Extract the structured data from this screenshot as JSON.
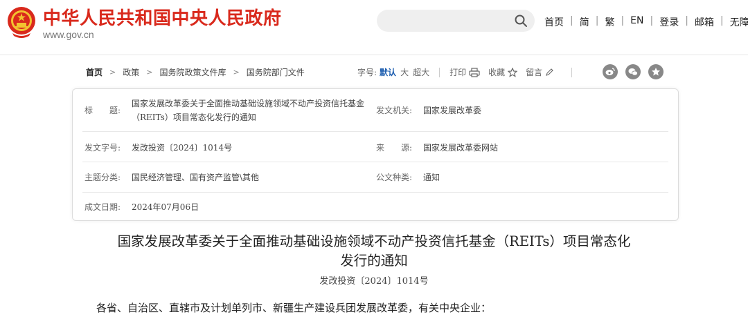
{
  "header": {
    "site_title": "中华人民共和国中央人民政府",
    "site_url": "www.gov.cn",
    "search_placeholder": "",
    "nav": [
      "首页",
      "简",
      "繁",
      "EN",
      "登录",
      "邮箱",
      "无障碍"
    ],
    "brand_color": "#d9291c"
  },
  "breadcrumb": [
    "首页",
    "政策",
    "国务院政策文件库",
    "国务院部门文件"
  ],
  "tools": {
    "font_label": "字号:",
    "font_default": "默认",
    "font_large": "大",
    "font_xlarge": "超大",
    "print": "打印",
    "favorite": "收藏",
    "comment": "留言"
  },
  "share_icons": [
    "weibo-icon",
    "wechat-icon",
    "qzone-icon"
  ],
  "info": {
    "title_label": "标　　题:",
    "title_line1": "国家发展改革委关于全面推动基础设施领域不动产投资信托基金",
    "title_line2": "（REITs）项目常态化发行的通知",
    "issuer_label": "发文机关:",
    "issuer": "国家发展改革委",
    "doc_no_label": "发文字号:",
    "doc_no": "发改投资〔2024〕1014号",
    "source_label": "来　　源:",
    "source": "国家发展改革委网站",
    "category_label": "主题分类:",
    "category": "国民经济管理、国有资产监管\\其他",
    "type_label": "公文种类:",
    "type": "通知",
    "date_label": "成文日期:",
    "date": "2024年07月06日"
  },
  "article": {
    "title_line1": "国家发展改革委关于全面推动基础设施领域不动产投资信托基金（REITs）项目常态化",
    "title_line2": "发行的通知",
    "doc_no": "发改投资〔2024〕1014号",
    "salutation": "各省、自治区、直辖市及计划单列市、新疆生产建设兵团发展改革委，有关中央企业："
  }
}
